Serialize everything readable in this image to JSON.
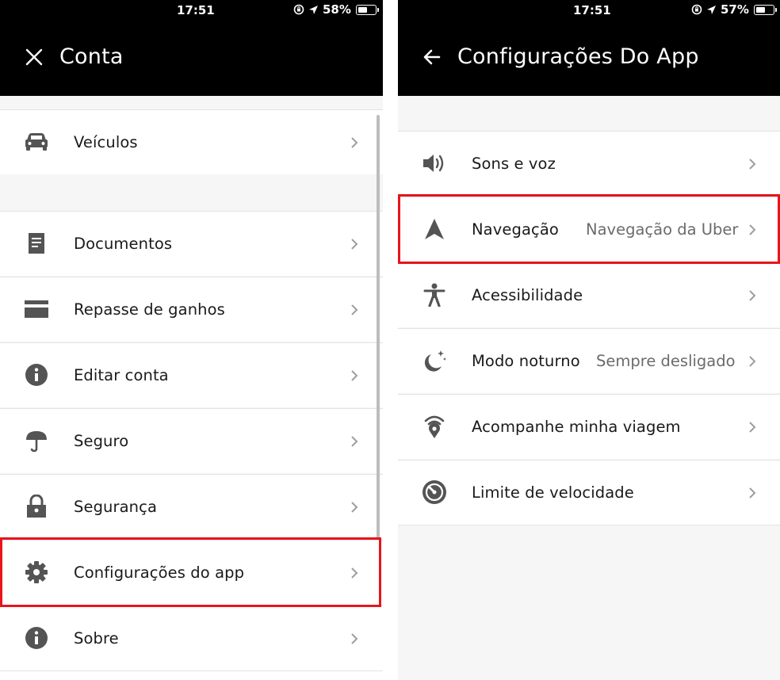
{
  "left": {
    "status": {
      "time": "17:51",
      "battery": "58%",
      "battery_level": 0.58
    },
    "header": {
      "title": "Conta",
      "icon": "close-icon"
    },
    "items": [
      {
        "label": "Veículos",
        "icon": "car-icon"
      },
      {
        "label": "Documentos",
        "icon": "document-icon"
      },
      {
        "label": "Repasse de ganhos",
        "icon": "card-icon"
      },
      {
        "label": "Editar conta",
        "icon": "info-icon"
      },
      {
        "label": "Seguro",
        "icon": "umbrella-icon"
      },
      {
        "label": "Segurança",
        "icon": "lock-icon"
      },
      {
        "label": "Configurações do app",
        "icon": "gear-icon"
      },
      {
        "label": "Sobre",
        "icon": "info-icon"
      }
    ]
  },
  "right": {
    "status": {
      "time": "17:51",
      "battery": "57%",
      "battery_level": 0.57
    },
    "header": {
      "title": "Configurações Do App",
      "icon": "back-arrow-icon"
    },
    "items": [
      {
        "label": "Sons e voz",
        "icon": "speaker-icon"
      },
      {
        "label": "Navegação",
        "value": "Navegação da Uber",
        "icon": "navigation-arrow-icon"
      },
      {
        "label": "Acessibilidade",
        "icon": "accessibility-icon"
      },
      {
        "label": "Modo noturno",
        "value": "Sempre desligado",
        "icon": "moon-icon"
      },
      {
        "label": "Acompanhe minha viagem",
        "icon": "location-signal-icon"
      },
      {
        "label": "Limite de velocidade",
        "icon": "speedometer-icon"
      }
    ]
  },
  "colors": {
    "header": "#000000",
    "highlight": "#e8141c",
    "icon": "#545454",
    "chevron": "#9e9e9e"
  }
}
